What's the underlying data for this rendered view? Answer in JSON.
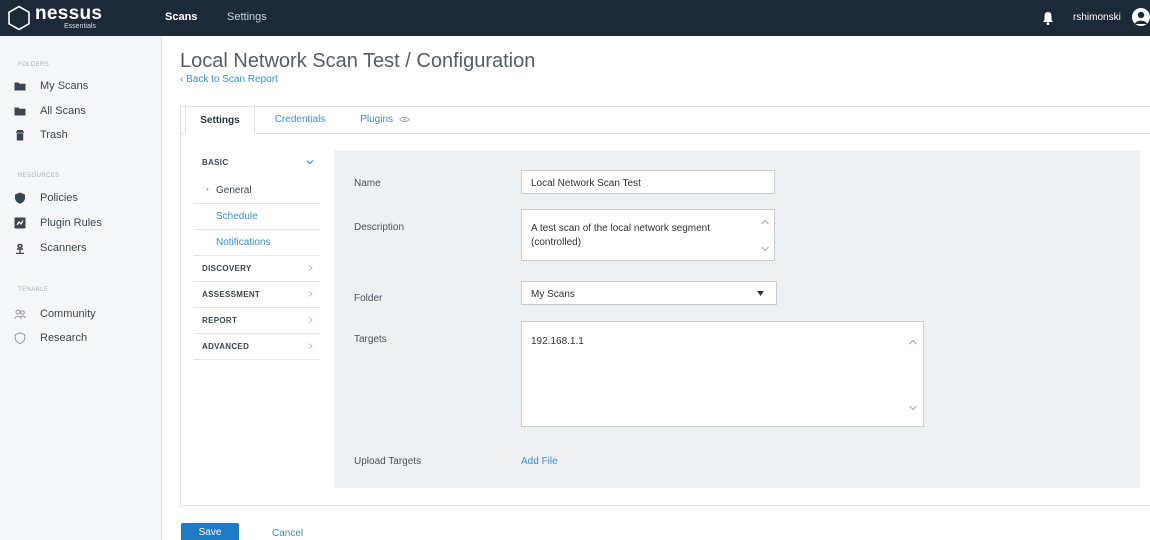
{
  "app": {
    "logo_name": "nessus",
    "logo_sub": "Essentials"
  },
  "topnav": {
    "scans": "Scans",
    "settings": "Settings",
    "username": "rshimonski"
  },
  "sidebar": {
    "folders_heading": "FOLDERS",
    "resources_heading": "RESOURCES",
    "tenable_heading": "TENABLE",
    "items": {
      "my_scans": "My Scans",
      "all_scans": "All Scans",
      "trash": "Trash",
      "policies": "Policies",
      "plugin_rules": "Plugin Rules",
      "scanners": "Scanners",
      "community": "Community",
      "research": "Research"
    }
  },
  "page": {
    "title": "Local Network Scan Test / Configuration",
    "back_link": "‹ Back to Scan Report"
  },
  "tabs": {
    "settings": "Settings",
    "credentials": "Credentials",
    "plugins": "Plugins"
  },
  "settings_nav": {
    "basic": "BASIC",
    "general": "General",
    "schedule": "Schedule",
    "notifications": "Notifications",
    "discovery": "DISCOVERY",
    "assessment": "ASSESSMENT",
    "report": "REPORT",
    "advanced": "ADVANCED"
  },
  "form": {
    "name_label": "Name",
    "name_value": "Local Network Scan Test",
    "description_label": "Description",
    "description_line1": "A test scan of the local network segment",
    "description_line2": "(controlled)",
    "folder_label": "Folder",
    "folder_value": "My Scans",
    "targets_label": "Targets",
    "targets_value": "192.168.1.1",
    "upload_label": "Upload Targets",
    "add_file": "Add File"
  },
  "actions": {
    "save": "Save",
    "cancel": "Cancel"
  },
  "colors": {
    "topbar": "#1c2a38",
    "link": "#3b8dd1",
    "save_button": "#1e7ac6",
    "form_background": "#eef0f2"
  }
}
